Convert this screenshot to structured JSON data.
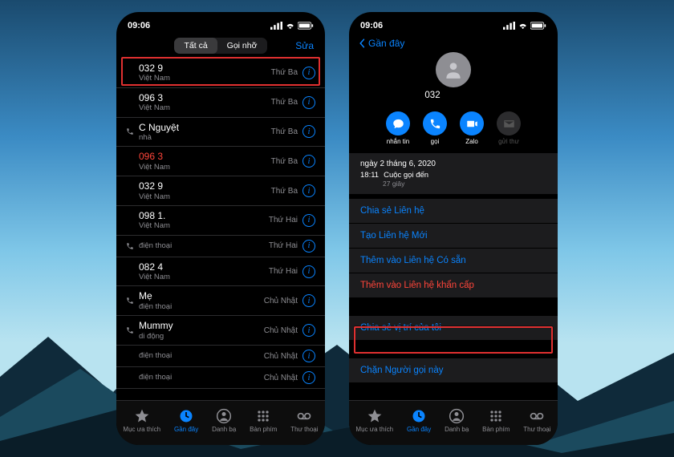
{
  "status": {
    "time": "09:06"
  },
  "left": {
    "segments": {
      "all": "Tất cả",
      "missed": "Gọi nhỡ"
    },
    "edit": "Sửa",
    "rows": [
      {
        "title": "032 9",
        "sub": "Việt Nam",
        "time": "Thứ Ba",
        "incoming": false,
        "missed": false
      },
      {
        "title": "096 3",
        "sub": "Việt Nam",
        "time": "Thứ Ba",
        "incoming": false,
        "missed": false
      },
      {
        "title": "C Nguyệt",
        "sub": "nhà",
        "time": "Thứ Ba",
        "incoming": true,
        "missed": false
      },
      {
        "title": "096 3",
        "sub": "Việt Nam",
        "time": "Thứ Ba",
        "incoming": false,
        "missed": true
      },
      {
        "title": "032 9",
        "sub": "Việt Nam",
        "time": "Thứ Ba",
        "incoming": false,
        "missed": false
      },
      {
        "title": "098 1.",
        "sub": "Việt Nam",
        "time": "Thứ Hai",
        "incoming": false,
        "missed": false
      },
      {
        "title": "",
        "sub": "điện thoại",
        "time": "Thứ Hai",
        "incoming": true,
        "missed": false
      },
      {
        "title": "082 4",
        "sub": "Việt Nam",
        "time": "Thứ Hai",
        "incoming": false,
        "missed": false
      },
      {
        "title": "Mẹ",
        "sub": "điện thoại",
        "time": "Chủ Nhật",
        "incoming": true,
        "missed": false
      },
      {
        "title": "Mummy",
        "sub": "di động",
        "time": "Chủ Nhật",
        "incoming": true,
        "missed": false
      },
      {
        "title": "",
        "sub": "điện thoại",
        "time": "Chủ Nhật",
        "incoming": false,
        "missed": false
      },
      {
        "title": "",
        "sub": "điện thoại",
        "time": "Chủ Nhật",
        "incoming": false,
        "missed": false
      }
    ]
  },
  "right": {
    "back": "Gần đây",
    "number": "032",
    "actions": {
      "message": "nhắn tin",
      "call": "gọi",
      "video": "Zalo",
      "mail": "gửi thư"
    },
    "date": "ngày 2 tháng 6, 2020",
    "call_time": "18:11",
    "call_label": "Cuộc gọi đến",
    "call_duration": "27 giây",
    "links": {
      "share": "Chia sẻ Liên hệ",
      "create": "Tạo Liên hệ Mới",
      "addExisting": "Thêm vào Liên hệ Có sẵn",
      "addEmergency": "Thêm vào Liên hệ khẩn cấp",
      "shareLocation": "Chia sẻ vị trí của tôi",
      "block": "Chặn Người gọi này"
    }
  },
  "tabs": {
    "favorites": "Mục ưa thích",
    "recents": "Gần đây",
    "contacts": "Danh bạ",
    "keypad": "Bàn phím",
    "voicemail": "Thư thoại"
  }
}
